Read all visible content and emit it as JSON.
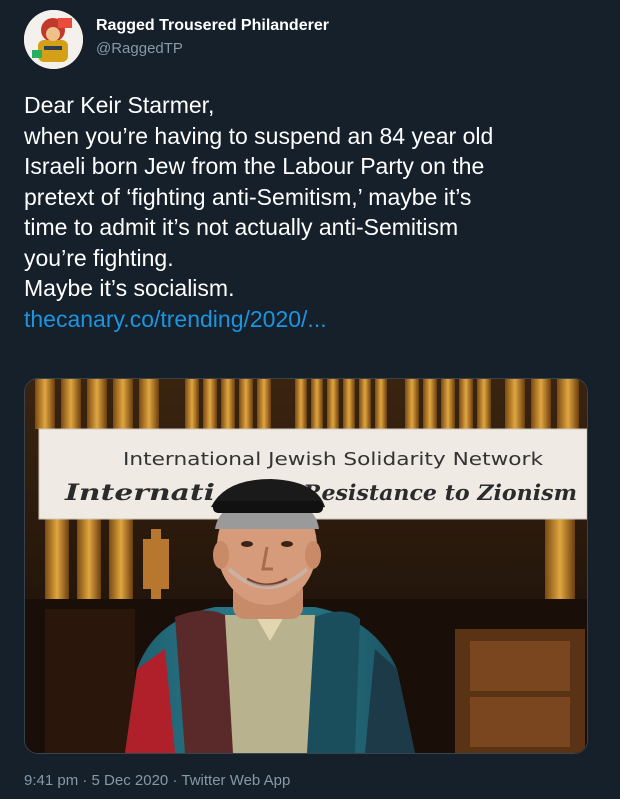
{
  "author": {
    "display_name": "Ragged Trousered Philanderer",
    "handle": "@RaggedTP"
  },
  "tweet": {
    "lines": [
      "Dear Keir Starmer,",
      "when you’re having to suspend an 84 year old",
      "Israeli born Jew from the Labour Party on the",
      "pretext of ‘fighting anti-Semitism,’ maybe it’s",
      "time to admit it’s not actually anti-Semitism",
      "you’re fighting.",
      "Maybe it’s socialism."
    ],
    "link": "thecanary.co/trending/2020/..."
  },
  "media": {
    "banner_line1": "International Jewish Solidarity Network",
    "banner_line2_left": "Internati",
    "banner_line2_right": "l Resistance to Zionism"
  },
  "footer": {
    "time": "9:41 pm",
    "separator": "·",
    "date": "5 Dec 2020",
    "source": "Twitter Web App"
  },
  "colors": {
    "background": "#15202b",
    "text": "#ffffff",
    "muted": "#8899a6",
    "link": "#1b95e0"
  }
}
